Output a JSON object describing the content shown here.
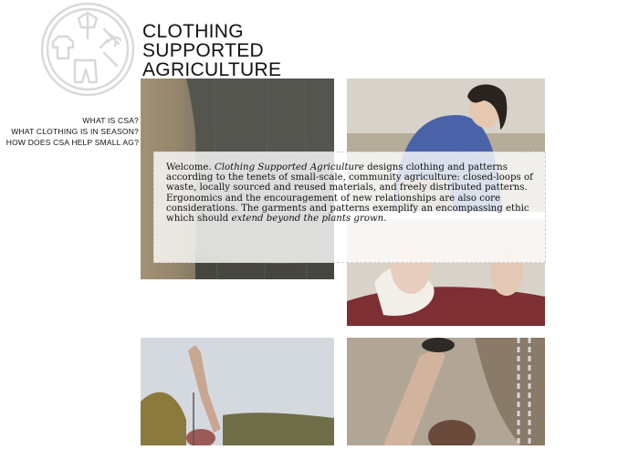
{
  "site": {
    "title_lines": [
      "CLOTHING",
      "SUPPORTED",
      "AGRICULTURE"
    ]
  },
  "nav": {
    "items": [
      {
        "label": "WHAT IS CSA?"
      },
      {
        "label": "WHAT CLOTHING IS IN SEASON?"
      },
      {
        "label": "HOW DOES CSA HELP SMALL AG?"
      }
    ]
  },
  "welcome": {
    "t1": "Welcome. ",
    "em1": "Clothing Supported Agriculture",
    "t2": " designs clothing and patterns according to the tenets of small-scale, community agriculture: closed-loops of waste, locally sourced and reused materials, and freely distributed patterns. Ergonomics and the encouragement of new relationships are also core considerations. The garments and patterns exemplify an encompassing ethic which should ",
    "em2": "extend beyond the plants grown."
  },
  "colors": {
    "text": "#111111",
    "logo_line": "#d8d8d8",
    "background": "#ffffff"
  },
  "icons": {
    "logo": "csa-emblem-icon"
  }
}
